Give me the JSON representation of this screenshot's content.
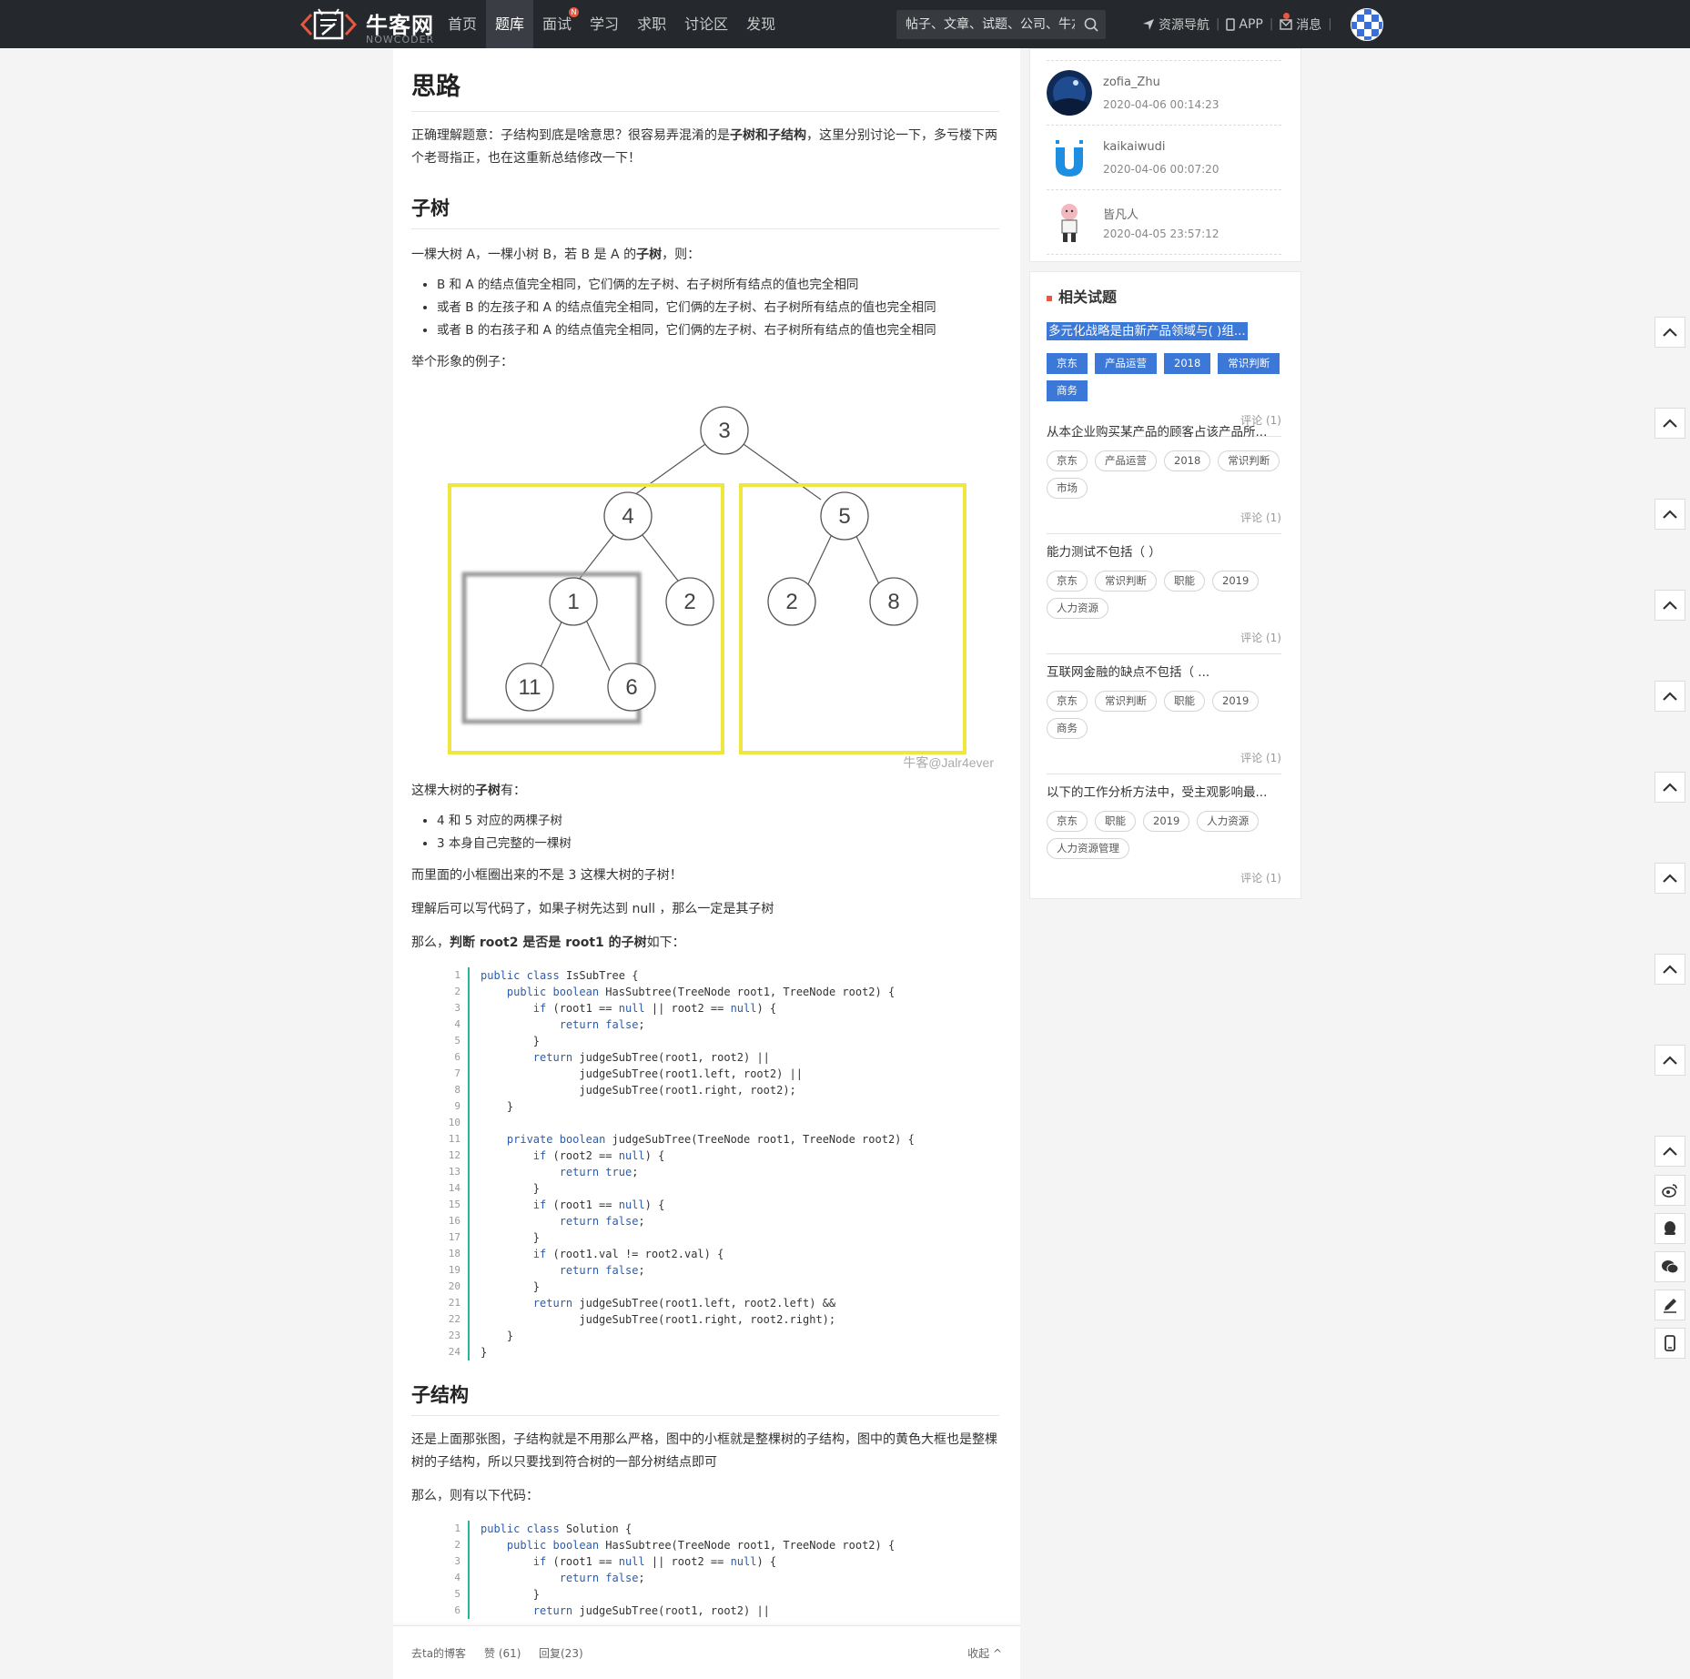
{
  "header": {
    "logo_text": "牛客网",
    "logo_sub": "NOWCODER",
    "nav": [
      {
        "label": "首页",
        "active": false,
        "badge": ""
      },
      {
        "label": "题库",
        "active": true,
        "badge": ""
      },
      {
        "label": "面试",
        "active": false,
        "badge": "N"
      },
      {
        "label": "学习",
        "active": false,
        "badge": ""
      },
      {
        "label": "求职",
        "active": false,
        "badge": ""
      },
      {
        "label": "讨论区",
        "active": false,
        "badge": ""
      },
      {
        "label": "发现",
        "active": false,
        "badge": ""
      }
    ],
    "search_placeholder": "帖子、文章、试题、公司、牛友",
    "links": {
      "resources": "资源导航",
      "app": "APP",
      "messages": "消息"
    }
  },
  "article": {
    "h_idea": "思路",
    "p_intro_a": "正确理解题意：子结构到底是啥意思？很容易弄混淆的是",
    "p_intro_b": "子树和子结构",
    "p_intro_c": "，这里分别讨论一下，多亏楼下两个老哥指正，也在这重新总结修改一下！",
    "h_subtree": "子树",
    "p_def_a": "一棵大树 A，一棵小树 B，若 B 是 A 的",
    "p_def_b": "子树",
    "p_def_c": "，则：",
    "def_items": [
      "B 和 A 的结点值完全相同，它们俩的左子树、右子树所有结点的值也完全相同",
      "或者 B 的左孩子和 A 的结点值完全相同，它们俩的左子树、右子树所有结点的值也完全相同",
      "或者 B 的右孩子和 A 的结点值完全相同，它们俩的左子树、右子树所有结点的值也完全相同"
    ],
    "p_example": "举个形象的例子：",
    "tree_nodes": [
      "3",
      "4",
      "5",
      "1",
      "2",
      "2",
      "8",
      "11",
      "6"
    ],
    "watermark": "牛客@Jalr4ever",
    "p_has_a": "这棵大树的",
    "p_has_b": "子树",
    "p_has_c": "有：",
    "has_items": [
      "4 和 5 对应的两棵子树",
      "3 本身自己完整的一棵树"
    ],
    "p_inner": "而里面的小框圈出来的不是 3 这棵大树的子树！",
    "p_null": "理解后可以写代码了，如果子树先达到 null ，那么一定是其子树",
    "p_judge_a": "那么，",
    "p_judge_b": "判断 root2 是否是 root1 的子树",
    "p_judge_c": "如下：",
    "code1": [
      {
        "kw": "",
        "text": "public class IsSubTree {"
      },
      {
        "kw": "",
        "text": "    public boolean HasSubtree(TreeNode root1, TreeNode root2) {"
      },
      {
        "kw": "",
        "text": "        if (root1 == null || root2 == null) {"
      },
      {
        "kw": "",
        "text": "            return false;"
      },
      {
        "kw": "",
        "text": "        }"
      },
      {
        "kw": "",
        "text": "        return judgeSubTree(root1, root2) ||"
      },
      {
        "kw": "",
        "text": "               judgeSubTree(root1.left, root2) ||"
      },
      {
        "kw": "",
        "text": "               judgeSubTree(root1.right, root2);"
      },
      {
        "kw": "",
        "text": "    }"
      },
      {
        "kw": "",
        "text": ""
      },
      {
        "kw": "",
        "text": "    private boolean judgeSubTree(TreeNode root1, TreeNode root2) {"
      },
      {
        "kw": "",
        "text": "        if (root2 == null) {"
      },
      {
        "kw": "",
        "text": "            return true;"
      },
      {
        "kw": "",
        "text": "        }"
      },
      {
        "kw": "",
        "text": "        if (root1 == null) {"
      },
      {
        "kw": "",
        "text": "            return false;"
      },
      {
        "kw": "",
        "text": "        }"
      },
      {
        "kw": "",
        "text": "        if (root1.val != root2.val) {"
      },
      {
        "kw": "",
        "text": "            return false;"
      },
      {
        "kw": "",
        "text": "        }"
      },
      {
        "kw": "",
        "text": "        return judgeSubTree(root1.left, root2.left) &&"
      },
      {
        "kw": "",
        "text": "               judgeSubTree(root1.right, root2.right);"
      },
      {
        "kw": "",
        "text": "    }"
      },
      {
        "kw": "",
        "text": "}"
      }
    ],
    "h_substructure": "子结构",
    "p_sub": "还是上面那张图，子结构就是不用那么严格，图中的小框就是整棵树的子结构，图中的黄色大框也是整棵树的子结构，所以只要找到符合树的一部分树结点即可",
    "p_code2": "那么，则有以下代码：",
    "code2": [
      {
        "kw": "",
        "text": "public class Solution {"
      },
      {
        "kw": "",
        "text": "    public boolean HasSubtree(TreeNode root1, TreeNode root2) {"
      },
      {
        "kw": "",
        "text": "        if (root1 == null || root2 == null) {"
      },
      {
        "kw": "",
        "text": "            return false;"
      },
      {
        "kw": "",
        "text": "        }"
      },
      {
        "kw": "",
        "text": "        return judgeSubTree(root1, root2) ||"
      }
    ],
    "bottom": {
      "blog": "去ta的博客",
      "like": "赞 (61)",
      "reply": "回复(23)",
      "collapse": "收起 ^"
    }
  },
  "replies": [
    {
      "name": "zofia_Zhu",
      "time": "2020-04-06 00:14:23"
    },
    {
      "name": "kaikaiwudi",
      "time": "2020-04-06 00:07:20"
    },
    {
      "name": "皆凡人",
      "time": "2020-04-05 23:57:12"
    }
  ],
  "related": {
    "title": "相关试题",
    "items": [
      {
        "q": "多元化战略是由新产品领域与( )组...",
        "tags": [
          "京东",
          "产品运营",
          "2018",
          "常识判断",
          "商务"
        ],
        "comments": "评论 (1)",
        "highlight": true
      },
      {
        "q": "从本企业购买某产品的顾客占该产品所...",
        "tags": [
          "京东",
          "产品运营",
          "2018",
          "常识判断",
          "市场"
        ],
        "comments": "评论 (1)",
        "highlight": false
      },
      {
        "q": "能力测试不包括（ ）",
        "tags": [
          "京东",
          "常识判断",
          "职能",
          "2019",
          "人力资源"
        ],
        "comments": "评论 (1)",
        "highlight": false
      },
      {
        "q": "互联网金融的缺点不包括（ ...",
        "tags": [
          "京东",
          "常识判断",
          "职能",
          "2019",
          "商务"
        ],
        "comments": "评论 (1)",
        "highlight": false
      },
      {
        "q": "以下的工作分析方法中，受主观影响最...",
        "tags": [
          "京东",
          "职能",
          "2019",
          "人力资源",
          "人力资源管理"
        ],
        "comments": "评论 (1)",
        "highlight": false
      }
    ]
  },
  "float_buttons": [
    "chevron-up-icon",
    "chevron-up-icon",
    "chevron-up-icon",
    "chevron-up-icon",
    "chevron-up-icon",
    "chevron-up-icon",
    "chevron-up-icon",
    "chevron-up-icon",
    "chevron-up-icon",
    "chevron-up-icon",
    "weibo-icon",
    "qq-icon",
    "wechat-icon",
    "edit-icon",
    "mobile-icon"
  ],
  "colors": {
    "topbar": "#25282c",
    "accent": "#26b59a",
    "keyword": "#2a5db0",
    "highlight": "#3b78d8",
    "badge": "#e8573f",
    "yellow_box": "#f0e640",
    "gray_box": "#9a9a9a"
  }
}
